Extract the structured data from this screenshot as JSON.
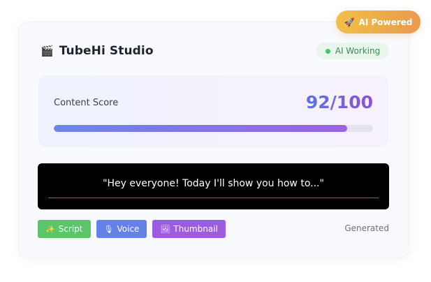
{
  "badge": {
    "icon": "🚀",
    "icon_name": "rocket-icon",
    "label": "AI Powered"
  },
  "header": {
    "logo": "🎬",
    "logo_name": "clapperboard-icon",
    "title": "TubeHi Studio",
    "status": {
      "label": "AI Working",
      "color": "#4cc56a"
    }
  },
  "score": {
    "label": "Content Score",
    "value_text": "92/100",
    "value": 92,
    "max": 100
  },
  "caption": {
    "text": "\"Hey everyone! Today I'll show you how to...\""
  },
  "tags": [
    {
      "icon": "✨",
      "icon_name": "sparkles-icon",
      "label": "Script",
      "color": "#5cc46a"
    },
    {
      "icon": "🎙",
      "icon_name": "microphone-icon",
      "label": "Voice",
      "color": "#6381e6"
    },
    {
      "icon": "🖼",
      "icon_name": "picture-icon",
      "label": "Thumbnail",
      "color": "#9d5be0"
    }
  ],
  "footer": {
    "status": "Generated"
  },
  "colors": {
    "accent_start": "#5c73e6",
    "accent_end": "#8a52d6",
    "badge_start": "#f0c04a",
    "badge_end": "#ea9a4e"
  }
}
